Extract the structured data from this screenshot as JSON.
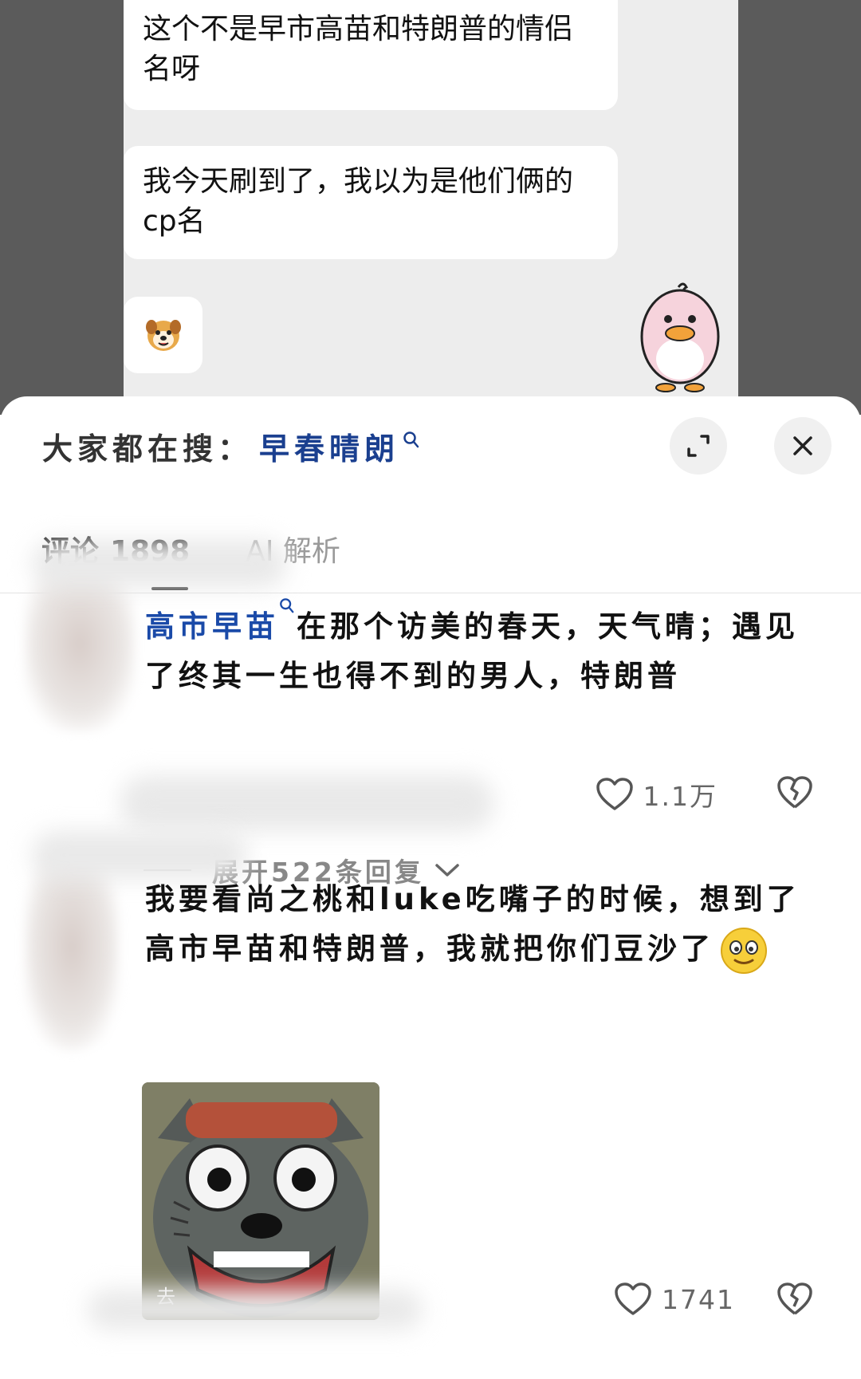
{
  "chat": {
    "message_1": "这个不是早市高苗和特朗普的情侣名呀",
    "message_2": "我今天刷到了，我以为是他们俩的cp名",
    "sticker_name": "dog-face-sticker",
    "penguin_sticker": "pink-penguin-sticker"
  },
  "sheet": {
    "search_label": "大家都在搜：",
    "search_term": "早春晴朗",
    "expand_icon": "expand-icon",
    "close_icon": "close-icon",
    "tabs": [
      {
        "label": "评论",
        "count": "1898"
      },
      {
        "label": "AI 解析"
      }
    ]
  },
  "comments": [
    {
      "hashtag": "高市早苗",
      "text": "在那个访美的春天，天气晴；遇见了终其一生也得不到的男人，特朗普",
      "likes": "1.1万",
      "expand_replies": "展开522条回复"
    },
    {
      "text": "我要看尚之桃和luke吃嘴子的时候，想到了高市早苗和特朗普，我就把你们豆沙了",
      "sticker_caption": "去",
      "likes": "1741"
    }
  ],
  "colors": {
    "accent_blue": "#1a3f8f",
    "hashtag_blue": "#1a4aa8",
    "chat_background": "#ededed",
    "backdrop": "#5b5b5b"
  }
}
